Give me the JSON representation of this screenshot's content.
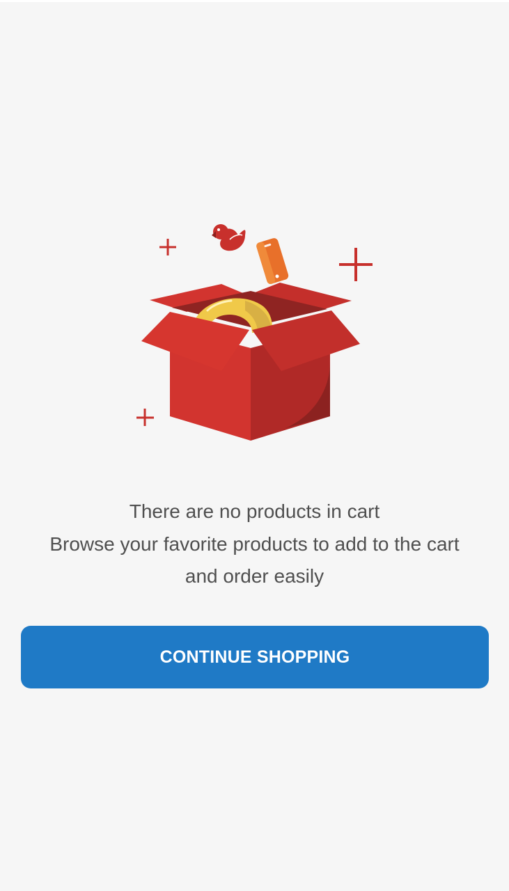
{
  "empty_cart": {
    "illustration_icon": "open-gift-box-icon",
    "message_lines": [
      "There are no products in cart",
      "Browse your favorite products to add to the cart",
      "and order easily"
    ],
    "cta_label": "CONTINUE SHOPPING"
  },
  "colors": {
    "background": "#f6f6f6",
    "accent": "#1f7ac6",
    "box_red": "#d0332f",
    "text": "#4f4f4f"
  }
}
